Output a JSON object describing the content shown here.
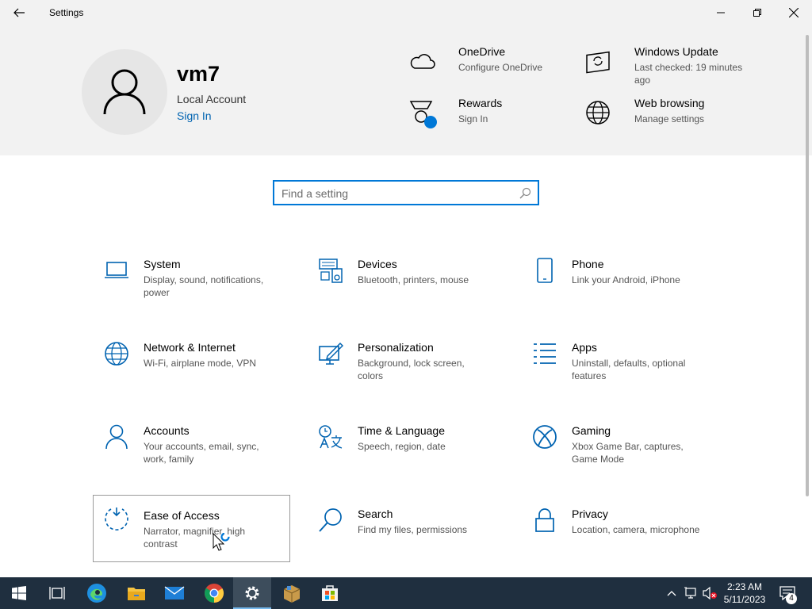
{
  "window": {
    "title": "Settings",
    "back_icon": "back-arrow-icon",
    "controls": [
      "minimize-icon",
      "maximize-icon",
      "close-icon"
    ]
  },
  "header": {
    "username": "vm7",
    "account_type": "Local Account",
    "sign_in": "Sign In",
    "quick_links": [
      {
        "title": "OneDrive",
        "subtitle": "Configure OneDrive",
        "icon": "cloud-icon"
      },
      {
        "title": "Windows Update",
        "subtitle": "Last checked: 19 minutes ago",
        "icon": "windows-update-icon"
      },
      {
        "title": "Rewards",
        "subtitle": "Sign In",
        "icon": "rewards-icon"
      },
      {
        "title": "Web browsing",
        "subtitle": "Manage settings",
        "icon": "globe-icon"
      }
    ]
  },
  "search": {
    "placeholder": "Find a setting",
    "value": ""
  },
  "categories": [
    {
      "title": "System",
      "desc": "Display, sound, notifications, power",
      "icon": "laptop-icon"
    },
    {
      "title": "Devices",
      "desc": "Bluetooth, printers, mouse",
      "icon": "devices-icon"
    },
    {
      "title": "Phone",
      "desc": "Link your Android, iPhone",
      "icon": "phone-icon"
    },
    {
      "title": "Network & Internet",
      "desc": "Wi-Fi, airplane mode, VPN",
      "icon": "globe-icon"
    },
    {
      "title": "Personalization",
      "desc": "Background, lock screen, colors",
      "icon": "personalization-icon"
    },
    {
      "title": "Apps",
      "desc": "Uninstall, defaults, optional features",
      "icon": "apps-list-icon"
    },
    {
      "title": "Accounts",
      "desc": "Your accounts, email, sync, work, family",
      "icon": "person-icon"
    },
    {
      "title": "Time & Language",
      "desc": "Speech, region, date",
      "icon": "time-language-icon"
    },
    {
      "title": "Gaming",
      "desc": "Xbox Game Bar, captures, Game Mode",
      "icon": "xbox-icon"
    },
    {
      "title": "Ease of Access",
      "desc": "Narrator, magnifier, high contrast",
      "icon": "ease-of-access-icon"
    },
    {
      "title": "Search",
      "desc": "Find my files, permissions",
      "icon": "search-icon"
    },
    {
      "title": "Privacy",
      "desc": "Location, camera, microphone",
      "icon": "lock-icon"
    }
  ],
  "taskbar": {
    "apps": [
      "start-icon",
      "task-view-icon",
      "edge-icon",
      "file-explorer-icon",
      "mail-icon",
      "chrome-icon",
      "settings-gear-icon",
      "package-icon",
      "store-icon"
    ],
    "active_app": "settings-gear-icon",
    "time": "2:23 AM",
    "date": "5/11/2023",
    "notification_count": "4"
  },
  "colors": {
    "accent": "#0078d7",
    "link": "#0063b1",
    "header_bg": "#f2f2f2",
    "taskbar_bg": "#1f2f3f"
  }
}
